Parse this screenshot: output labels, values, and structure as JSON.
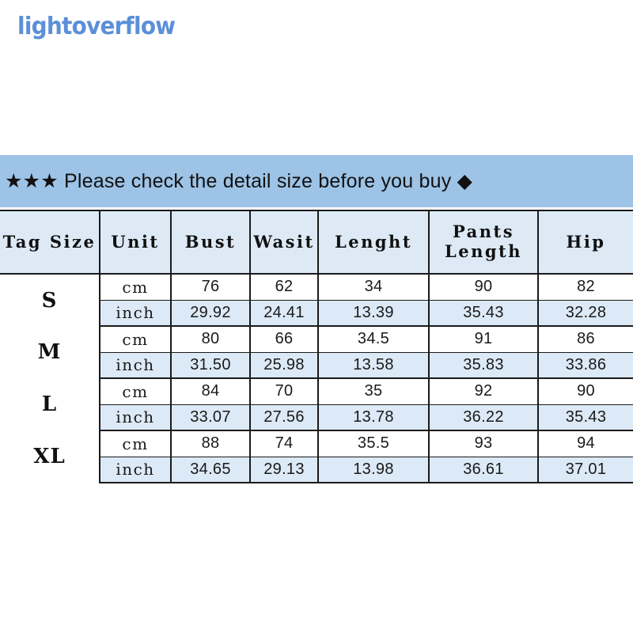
{
  "watermark": {
    "text": "lightoverflow",
    "color": "#5b8fd9"
  },
  "banner": {
    "text": "★★★ Please check the detail size before you buy ◆",
    "background_color": "#9dc3e6",
    "text_color": "#111111"
  },
  "table": {
    "header_background": "#ddeaf6",
    "inch_row_background": "#dce9f6",
    "cm_row_background": "#ffffff",
    "border_color": "#1a1a1a",
    "columns": [
      {
        "label": "Tag Size"
      },
      {
        "label": "Unit"
      },
      {
        "label": "Bust"
      },
      {
        "label": "Wasit"
      },
      {
        "label": "Lenght"
      },
      {
        "label": "Pants Length",
        "line1": "Pants",
        "line2": "Length"
      },
      {
        "label": "Hip"
      }
    ],
    "units": {
      "cm": "cm",
      "inch": "inch"
    },
    "rows": [
      {
        "size": "S",
        "cm": {
          "bust": "76",
          "waist": "62",
          "length": "34",
          "pants_length": "90",
          "hip": "82"
        },
        "inch": {
          "bust": "29.92",
          "waist": "24.41",
          "length": "13.39",
          "pants_length": "35.43",
          "hip": "32.28"
        }
      },
      {
        "size": "M",
        "cm": {
          "bust": "80",
          "waist": "66",
          "length": "34.5",
          "pants_length": "91",
          "hip": "86"
        },
        "inch": {
          "bust": "31.50",
          "waist": "25.98",
          "length": "13.58",
          "pants_length": "35.83",
          "hip": "33.86"
        }
      },
      {
        "size": "L",
        "cm": {
          "bust": "84",
          "waist": "70",
          "length": "35",
          "pants_length": "92",
          "hip": "90"
        },
        "inch": {
          "bust": "33.07",
          "waist": "27.56",
          "length": "13.78",
          "pants_length": "36.22",
          "hip": "35.43"
        }
      },
      {
        "size": "XL",
        "cm": {
          "bust": "88",
          "waist": "74",
          "length": "35.5",
          "pants_length": "93",
          "hip": "94"
        },
        "inch": {
          "bust": "34.65",
          "waist": "29.13",
          "length": "13.98",
          "pants_length": "36.61",
          "hip": "37.01"
        }
      }
    ]
  }
}
